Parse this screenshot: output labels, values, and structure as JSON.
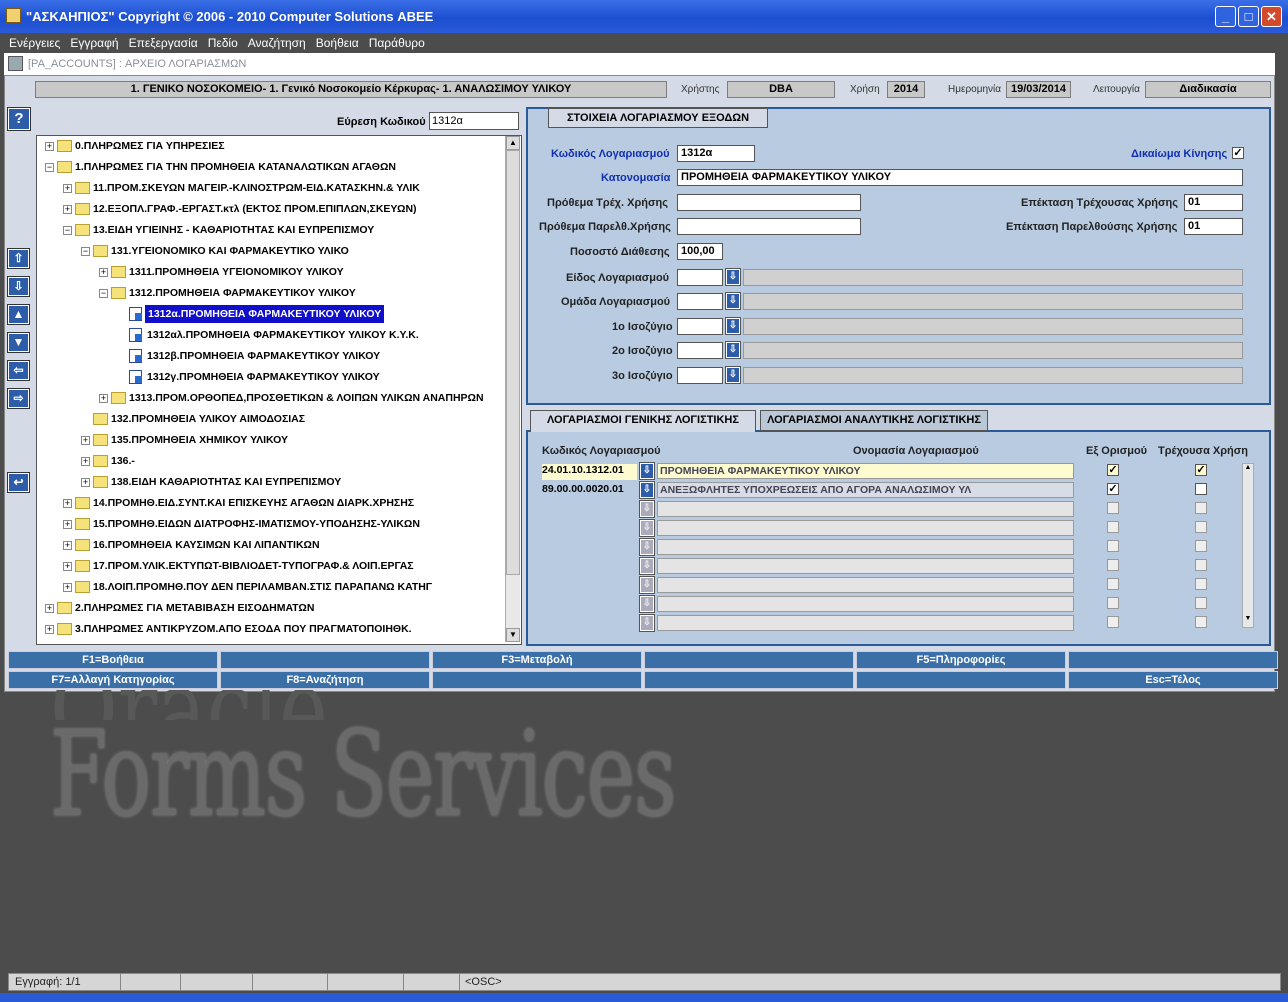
{
  "window": {
    "title": "\"ΑΣΚΑΗΠΙΟΣ\" Copyright © 2006 - 2010 Computer Solutions ΑΒΕΕ"
  },
  "menu": [
    "Ενέργειες",
    "Εγγραφή",
    "Επεξεργασία",
    "Πεδίο",
    "Αναζήτηση",
    "Βοήθεια",
    "Παράθυρο"
  ],
  "form": {
    "title": "[PA_ACCOUNTS]  :  ΑΡΧΕΙΟ ΛΟΓΑΡΙΑΣΜΩΝ"
  },
  "header": {
    "org": "1. ΓΕΝΙΚΟ ΝΟΣΟΚΟΜΕΙΟ- 1. Γενικό Νοσοκομείο Κέρκυρας- 1. ΑΝΑΛΩΣΙΜΟΥ ΥΛΙΚΟΥ",
    "user_label": "Χρήστης",
    "user": "DBA",
    "year_label": "Χρήση",
    "year": "2014",
    "date_label": "Ημερομηνία",
    "date": "19/03/2014",
    "mode_label": "Λειτουργία",
    "mode": "Διαδικασία"
  },
  "search": {
    "label": "Εύρεση Κωδικού",
    "value": "1312α"
  },
  "tree": [
    {
      "level": 0,
      "type": "folder",
      "toggle": "+",
      "label": "0.ΠΛΗΡΩΜΕΣ ΓΙΑ ΥΠΗΡΕΣΙΕΣ"
    },
    {
      "level": 0,
      "type": "folder",
      "toggle": "-",
      "label": "1.ΠΛΗΡΩΜΕΣ ΓΙΑ ΤΗΝ ΠΡΟΜΗΘΕΙΑ ΚΑΤΑΝΑΛΩΤΙΚΩΝ ΑΓΑΘΩΝ"
    },
    {
      "level": 1,
      "type": "folder",
      "toggle": "+",
      "label": "11.ΠΡΟΜ.ΣΚΕΥΩΝ ΜΑΓΕΙΡ.-ΚΛΙΝΟΣΤΡΩΜ-ΕΙΔ.ΚΑΤΑΣΚΗΝ.& ΥΛΙΚ"
    },
    {
      "level": 1,
      "type": "folder",
      "toggle": "+",
      "label": "12.ΕΞΟΠΛ.ΓΡΑΦ.-ΕΡΓΑΣΤ.κτλ (ΕΚΤΟΣ ΠΡΟΜ.ΕΠΙΠΛΩΝ,ΣΚΕΥΩΝ)"
    },
    {
      "level": 1,
      "type": "folder",
      "toggle": "-",
      "label": "13.ΕΙΔΗ ΥΓΙΕΙΝΗΣ - ΚΑΘΑΡΙΟΤΗΤΑΣ ΚΑΙ ΕΥΠΡΕΠΙΣΜΟΥ"
    },
    {
      "level": 2,
      "type": "folder",
      "toggle": "-",
      "label": "131.ΥΓΕΙΟΝΟΜΙΚΟ ΚΑΙ ΦΑΡΜΑΚΕΥΤΙΚΟ ΥΛΙΚΟ"
    },
    {
      "level": 3,
      "type": "folder",
      "toggle": "+",
      "label": "1311.ΠΡΟΜΗΘΕΙΑ ΥΓΕΙΟΝΟΜΙΚΟΥ ΥΛΙΚΟΥ"
    },
    {
      "level": 3,
      "type": "folder",
      "toggle": "-",
      "label": "1312.ΠΡΟΜΗΘΕΙΑ ΦΑΡΜΑΚΕΥΤΙΚΟΥ ΥΛΙΚΟΥ"
    },
    {
      "level": 4,
      "type": "leaf",
      "toggle": "",
      "label": "1312α.ΠΡΟΜΗΘΕΙΑ ΦΑΡΜΑΚΕΥΤΙΚΟΥ ΥΛΙΚΟΥ",
      "selected": true
    },
    {
      "level": 4,
      "type": "leaf",
      "toggle": "",
      "label": "1312αλ.ΠΡΟΜΗΘΕΙΑ ΦΑΡΜΑΚΕΥΤΙΚΟΥ ΥΛΙΚΟΥ Κ.Υ.Κ."
    },
    {
      "level": 4,
      "type": "leaf",
      "toggle": "",
      "label": "1312β.ΠΡΟΜΗΘΕΙΑ ΦΑΡΜΑΚΕΥΤΙΚΟΥ ΥΛΙΚΟΥ"
    },
    {
      "level": 4,
      "type": "leaf",
      "toggle": "",
      "label": "1312γ.ΠΡΟΜΗΘΕΙΑ ΦΑΡΜΑΚΕΥΤΙΚΟΥ ΥΛΙΚΟΥ"
    },
    {
      "level": 3,
      "type": "folder",
      "toggle": "+",
      "label": "1313.ΠΡΟΜ.ΟΡΘΟΠΕΔ,ΠΡΟΣΘΕΤΙΚΩΝ & ΛΟΙΠΩΝ ΥΛΙΚΩΝ ΑΝΑΠΗΡΩΝ"
    },
    {
      "level": 2,
      "type": "folder",
      "toggle": "",
      "label": "132.ΠΡΟΜΗΘΕΙΑ ΥΛΙΚΟΥ ΑΙΜΟΔΟΣΙΑΣ"
    },
    {
      "level": 2,
      "type": "folder",
      "toggle": "+",
      "label": "135.ΠΡΟΜΗΘΕΙΑ ΧΗΜΙΚΟΥ ΥΛΙΚΟΥ"
    },
    {
      "level": 2,
      "type": "folder",
      "toggle": "+",
      "label": "136.-"
    },
    {
      "level": 2,
      "type": "folder",
      "toggle": "+",
      "label": "138.ΕΙΔΗ ΚΑΘΑΡΙΟΤΗΤΑΣ ΚΑΙ ΕΥΠΡΕΠΙΣΜΟΥ"
    },
    {
      "level": 1,
      "type": "folder",
      "toggle": "+",
      "label": "14.ΠΡΟΜΗΘ.ΕΙΔ.ΣΥΝΤ.ΚΑΙ ΕΠΙΣΚΕΥΗΣ ΑΓΑΘΩΝ ΔΙΑΡΚ.ΧΡΗΣΗΣ"
    },
    {
      "level": 1,
      "type": "folder",
      "toggle": "+",
      "label": "15.ΠΡΟΜΗΘ.ΕΙΔΩΝ ΔΙΑΤΡΟΦΗΣ-ΙΜΑΤΙΣΜΟΥ-ΥΠΟΔΗΣΗΣ-ΥΛΙΚΩΝ"
    },
    {
      "level": 1,
      "type": "folder",
      "toggle": "+",
      "label": "16.ΠΡΟΜΗΘΕΙΑ ΚΑΥΣΙΜΩΝ ΚΑΙ ΛΙΠΑΝΤΙΚΩΝ"
    },
    {
      "level": 1,
      "type": "folder",
      "toggle": "+",
      "label": "17.ΠΡΟΜ.ΥΛΙΚ.ΕΚΤΥΠΩΤ-ΒΙΒΛΙΟΔΕΤ-ΤΥΠΟΓΡΑΦ.& ΛΟΙΠ.ΕΡΓΑΣ"
    },
    {
      "level": 1,
      "type": "folder",
      "toggle": "+",
      "label": "18.ΛΟΙΠ.ΠΡΟΜΗΘ.ΠΟΥ ΔΕΝ ΠΕΡΙΛΑΜΒΑΝ.ΣΤΙΣ ΠΑΡΑΠΑΝΩ ΚΑΤΗΓ"
    },
    {
      "level": 0,
      "type": "folder",
      "toggle": "+",
      "label": "2.ΠΛΗΡΩΜΕΣ ΓΙΑ ΜΕΤΑΒΙΒΑΣΗ ΕΙΣΟΔΗΜΑΤΩΝ"
    },
    {
      "level": 0,
      "type": "folder",
      "toggle": "+",
      "label": "3.ΠΛΗΡΩΜΕΣ ΑΝΤΙΚΡΥΖΟΜ.ΑΠΟ ΕΣΟΔΑ ΠΟΥ ΠΡΑΓΜΑΤΟΠΟΙΗΘΚ."
    }
  ],
  "detail": {
    "tab": "ΣΤΟΙΧΕΙΑ ΛΟΓΑΡΙΑΣΜΟΥ ΕΞΟΔΩΝ",
    "code_label": "Κωδικός Λογαριασμού",
    "code": "1312α",
    "move_right_label": "Δικαίωμα Κίνησης",
    "move_right_checked": true,
    "name_label": "Κατονομασία",
    "name": "ΠΡΟΜΗΘΕΙΑ ΦΑΡΜΑΚΕΥΤΙΚΟΥ ΥΛΙΚΟΥ",
    "prefix_cur_label": "Πρόθεμα Τρέχ. Χρήσης",
    "prefix_cur": "",
    "prefix_prev_label": "Πρόθεμα Παρελθ.Χρήσης",
    "prefix_prev": "",
    "ext_cur_label": "Επέκταση Τρέχουσας Χρήσης",
    "ext_cur": "01",
    "ext_prev_label": "Επέκταση Παρελθούσης Χρήσης",
    "ext_prev": "01",
    "percent_label": "Ποσοστό Διάθεσης",
    "percent": "100,00",
    "type_label": "Είδος Λογαριασμού",
    "group_label": "Ομάδα Λογαριασμού",
    "bal1_label": "1ο Ισοζύγιο",
    "bal2_label": "2ο Ισοζύγιο",
    "bal3_label": "3ο Ισοζύγιο"
  },
  "accounts": {
    "tab_general": "ΛΟΓΑΡΙΑΣΜΟΙ ΓΕΝΙΚΗΣ ΛΟΓΙΣΤΙΚΗΣ",
    "tab_analytic": "ΛΟΓΑΡΙΑΣΜΟΙ ΑΝΑΛΥΤΙΚΗΣ ΛΟΓΙΣΤΙΚΗΣ",
    "col_code": "Κωδικός Λογαριασμού",
    "col_name": "Ονομασία Λογαριασμού",
    "col_default": "Εξ Ορισμού",
    "col_current": "Τρέχουσα Χρήση",
    "rows": [
      {
        "code": "24.01.10.1312.01",
        "name": "ΠΡΟΜΗΘΕΙΑ ΦΑΡΜΑΚΕΥΤΙΚΟΥ ΥΛΙΚΟΥ",
        "default": true,
        "current": true
      },
      {
        "code": "89.00.00.0020.01",
        "name": "ΑΝΕΞΩΦΛΗΤΕΣ ΥΠΟΧΡΕΩΣΕΙΣ ΑΠΟ ΑΓΟΡΑ ΑΝΑΛΩΣΙΜΟΥ ΥΛ",
        "default": true,
        "current": false
      },
      {
        "code": "",
        "name": "",
        "default": false,
        "current": false
      },
      {
        "code": "",
        "name": "",
        "default": false,
        "current": false
      },
      {
        "code": "",
        "name": "",
        "default": false,
        "current": false
      },
      {
        "code": "",
        "name": "",
        "default": false,
        "current": false
      },
      {
        "code": "",
        "name": "",
        "default": false,
        "current": false
      },
      {
        "code": "",
        "name": "",
        "default": false,
        "current": false
      },
      {
        "code": "",
        "name": "",
        "default": false,
        "current": false
      }
    ]
  },
  "fkeys": {
    "row1": [
      "F1=Βοήθεια",
      "",
      "F3=Μεταβολή",
      "",
      "F5=Πληροφορίες",
      ""
    ],
    "row2": [
      "F7=Αλλαγή Κατηγορίας",
      "F8=Αναζήτηση",
      "",
      "",
      "",
      "Esc=Τέλος"
    ]
  },
  "watermark": "Forms Services",
  "status": {
    "record": "Εγγραφή: 1/1",
    "osc": "<OSC>"
  },
  "icons": {
    "up": "arrow-up-icon",
    "down": "arrow-down-icon",
    "left": "arrow-left-icon",
    "right": "arrow-right-icon",
    "help": "help-icon",
    "undo": "undo-icon"
  }
}
